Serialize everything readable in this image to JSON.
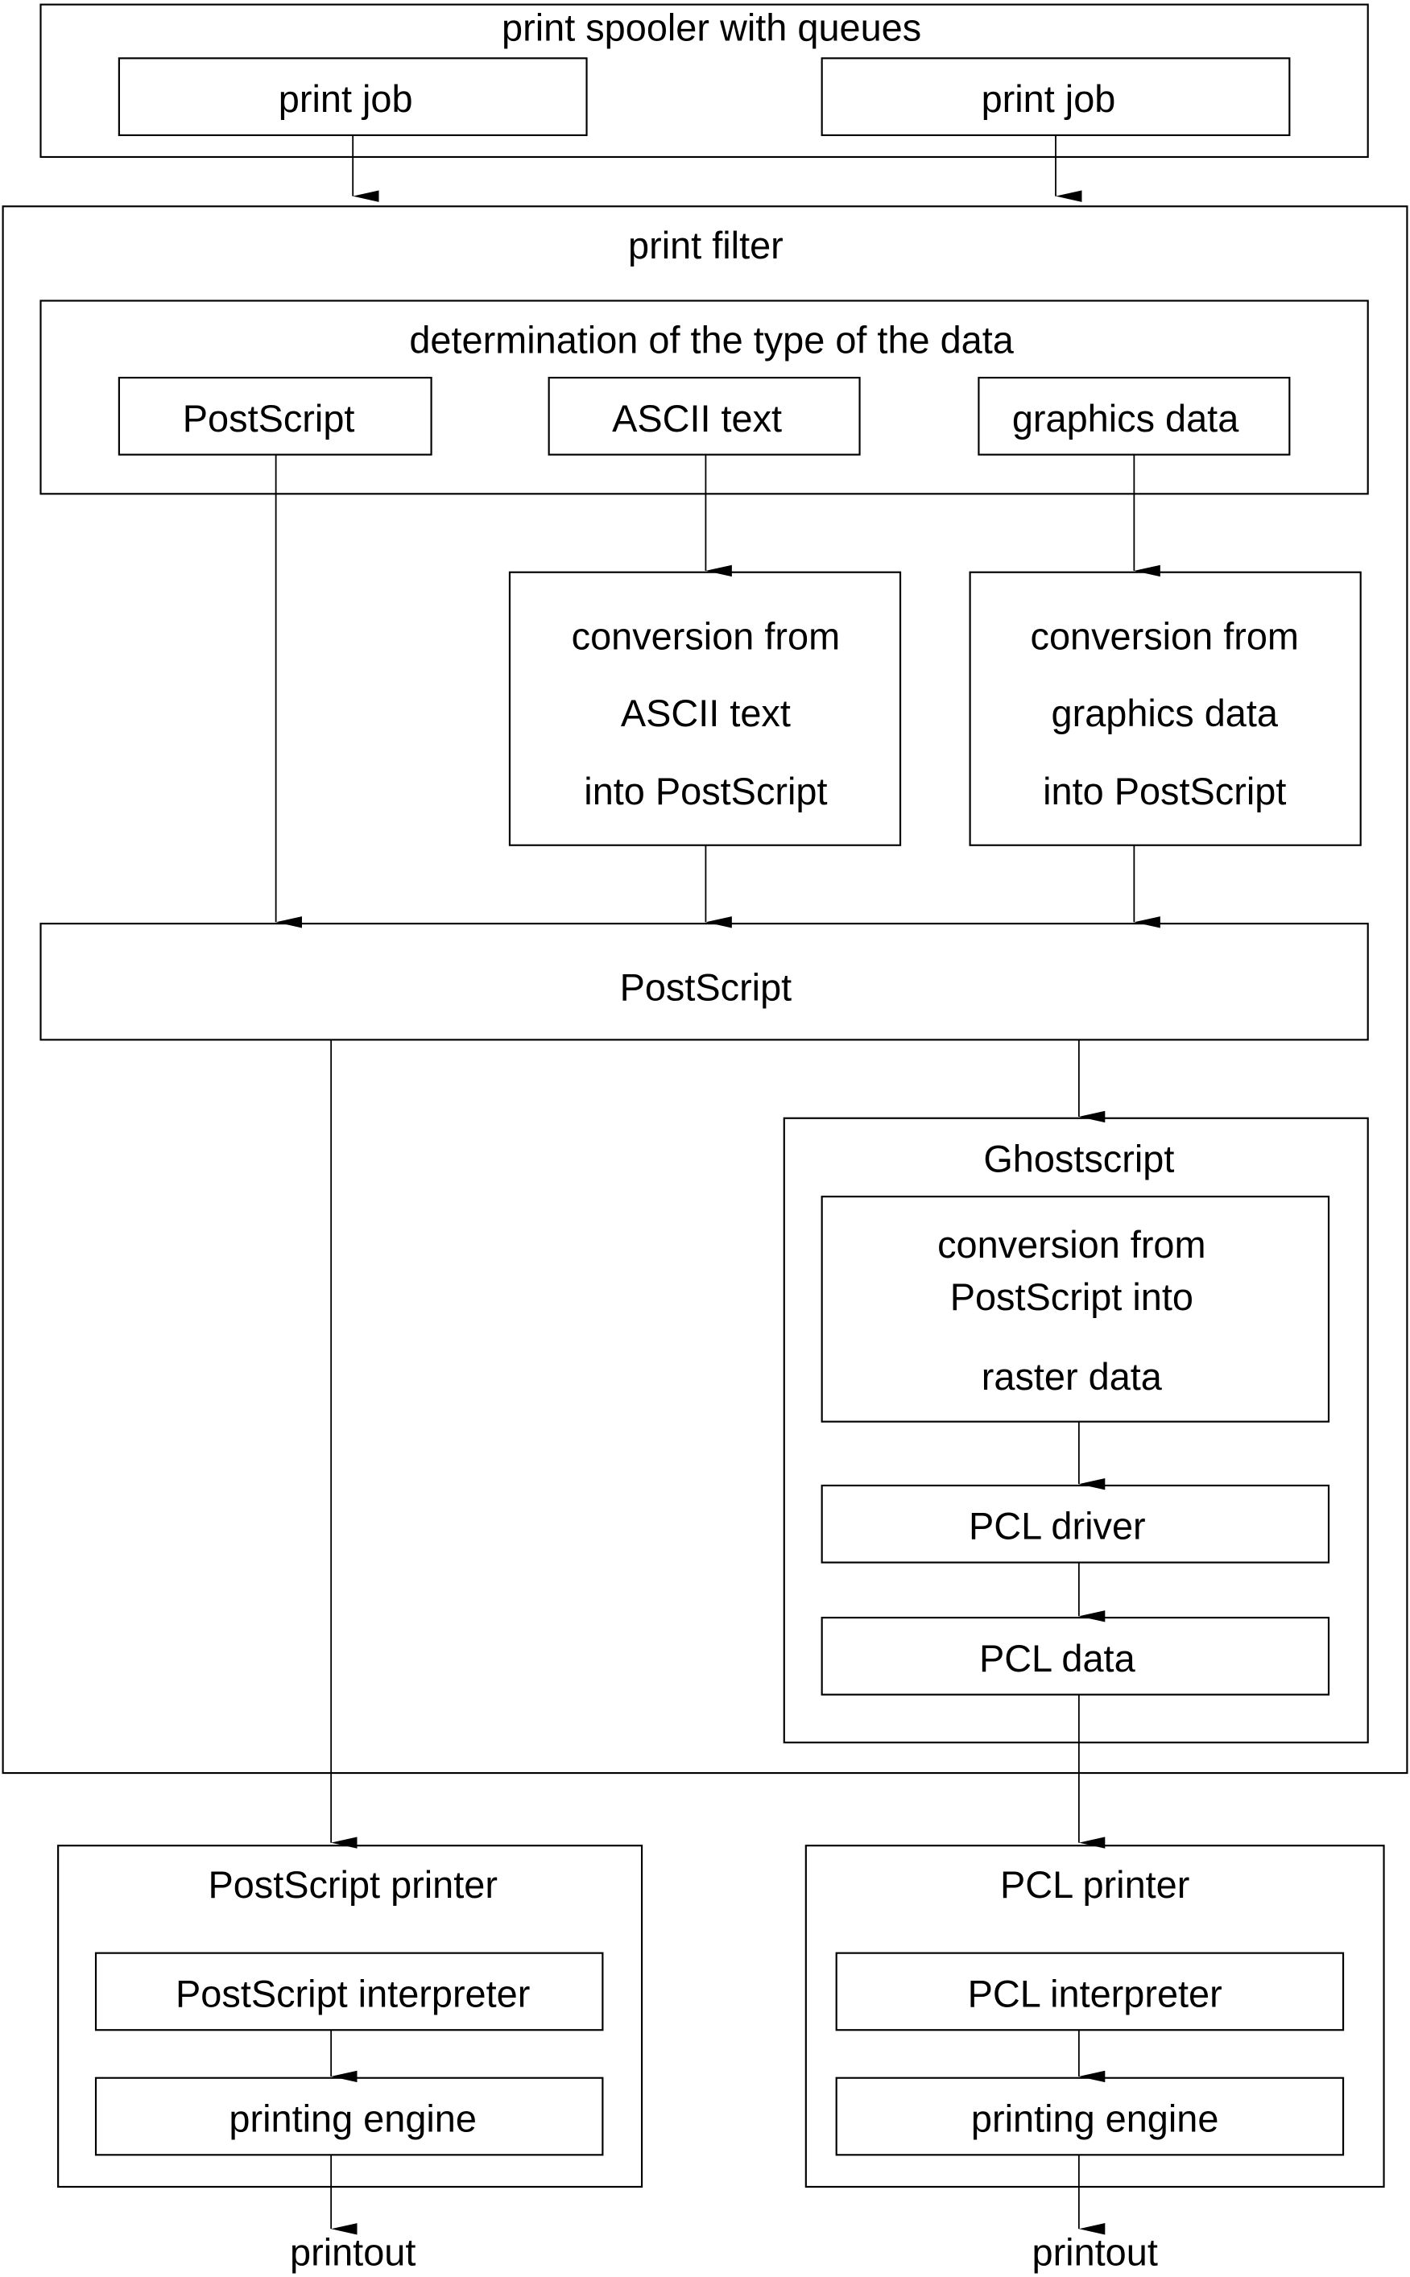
{
  "diagram": {
    "spooler": {
      "title": "print spooler with queues",
      "jobs": [
        "print job",
        "print job"
      ]
    },
    "filter": {
      "title": "print filter",
      "detection": {
        "title": "determination of the type of the data",
        "types": [
          "PostScript",
          "ASCII text",
          "graphics data"
        ]
      },
      "ascii_conversion": [
        "conversion from",
        "ASCII text",
        "into PostScript"
      ],
      "graphics_conversion": [
        "conversion from",
        "graphics data",
        "into PostScript"
      ],
      "postscript": "PostScript",
      "ghostscript": {
        "title": "Ghostscript",
        "conversion": [
          "conversion from",
          "PostScript into",
          "raster data"
        ],
        "driver": "PCL driver",
        "data": "PCL data"
      }
    },
    "postscript_printer": {
      "title": "PostScript printer",
      "interpreter": "PostScript interpreter",
      "engine": "printing engine",
      "output": "printout"
    },
    "pcl_printer": {
      "title": "PCL printer",
      "interpreter": "PCL interpreter",
      "engine": "printing engine",
      "output": "printout"
    }
  }
}
